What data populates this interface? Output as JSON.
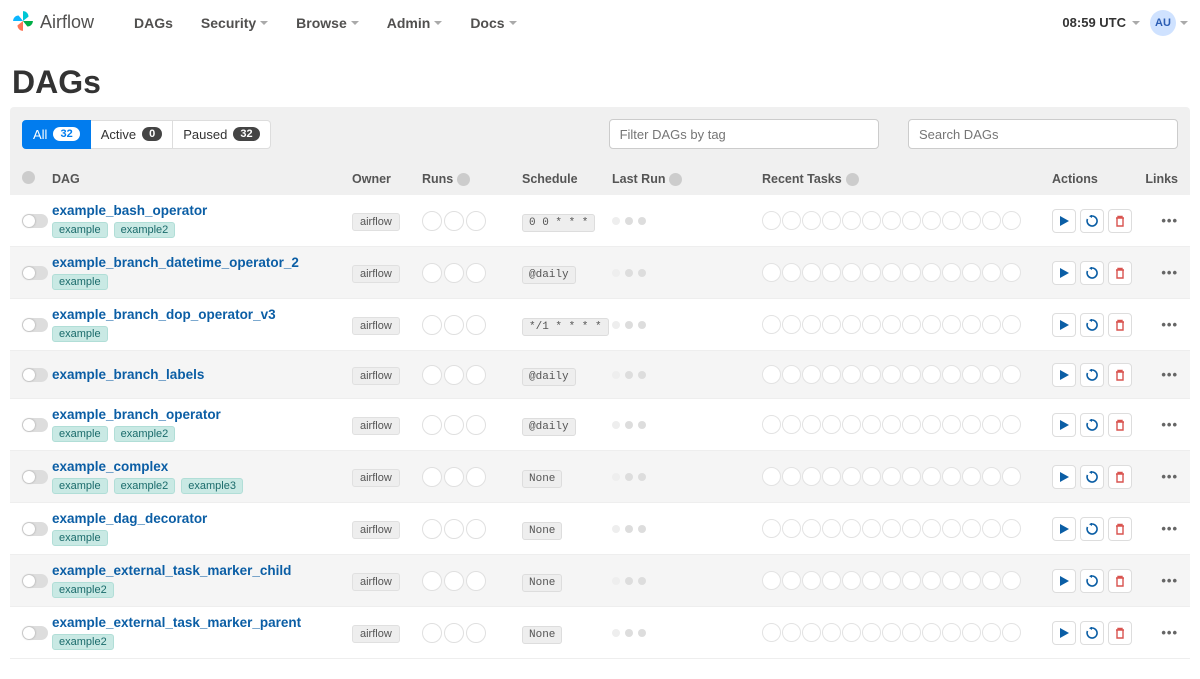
{
  "brand": "Airflow",
  "nav": {
    "items": [
      {
        "label": "DAGs",
        "dropdown": false
      },
      {
        "label": "Security",
        "dropdown": true
      },
      {
        "label": "Browse",
        "dropdown": true
      },
      {
        "label": "Admin",
        "dropdown": true
      },
      {
        "label": "Docs",
        "dropdown": true
      }
    ],
    "clock": "08:59 UTC",
    "user_initials": "AU"
  },
  "page_title": "DAGs",
  "filters": {
    "tabs": [
      {
        "label": "All",
        "count": "32",
        "active": true
      },
      {
        "label": "Active",
        "count": "0",
        "active": false
      },
      {
        "label": "Paused",
        "count": "32",
        "active": false
      }
    ],
    "tag_filter_placeholder": "Filter DAGs by tag",
    "search_placeholder": "Search DAGs"
  },
  "columns": {
    "dag": "DAG",
    "owner": "Owner",
    "runs": "Runs",
    "schedule": "Schedule",
    "last_run": "Last Run",
    "recent_tasks": "Recent Tasks",
    "actions": "Actions",
    "links": "Links"
  },
  "recent_task_slots": 13,
  "rows": [
    {
      "name": "example_bash_operator",
      "tags": [
        "example",
        "example2"
      ],
      "owner": "airflow",
      "schedule": "0 0 * * *"
    },
    {
      "name": "example_branch_datetime_operator_2",
      "tags": [
        "example"
      ],
      "owner": "airflow",
      "schedule": "@daily"
    },
    {
      "name": "example_branch_dop_operator_v3",
      "tags": [
        "example"
      ],
      "owner": "airflow",
      "schedule": "*/1 * * * *"
    },
    {
      "name": "example_branch_labels",
      "tags": [],
      "owner": "airflow",
      "schedule": "@daily"
    },
    {
      "name": "example_branch_operator",
      "tags": [
        "example",
        "example2"
      ],
      "owner": "airflow",
      "schedule": "@daily"
    },
    {
      "name": "example_complex",
      "tags": [
        "example",
        "example2",
        "example3"
      ],
      "owner": "airflow",
      "schedule": "None"
    },
    {
      "name": "example_dag_decorator",
      "tags": [
        "example"
      ],
      "owner": "airflow",
      "schedule": "None"
    },
    {
      "name": "example_external_task_marker_child",
      "tags": [
        "example2"
      ],
      "owner": "airflow",
      "schedule": "None"
    },
    {
      "name": "example_external_task_marker_parent",
      "tags": [
        "example2"
      ],
      "owner": "airflow",
      "schedule": "None"
    }
  ]
}
